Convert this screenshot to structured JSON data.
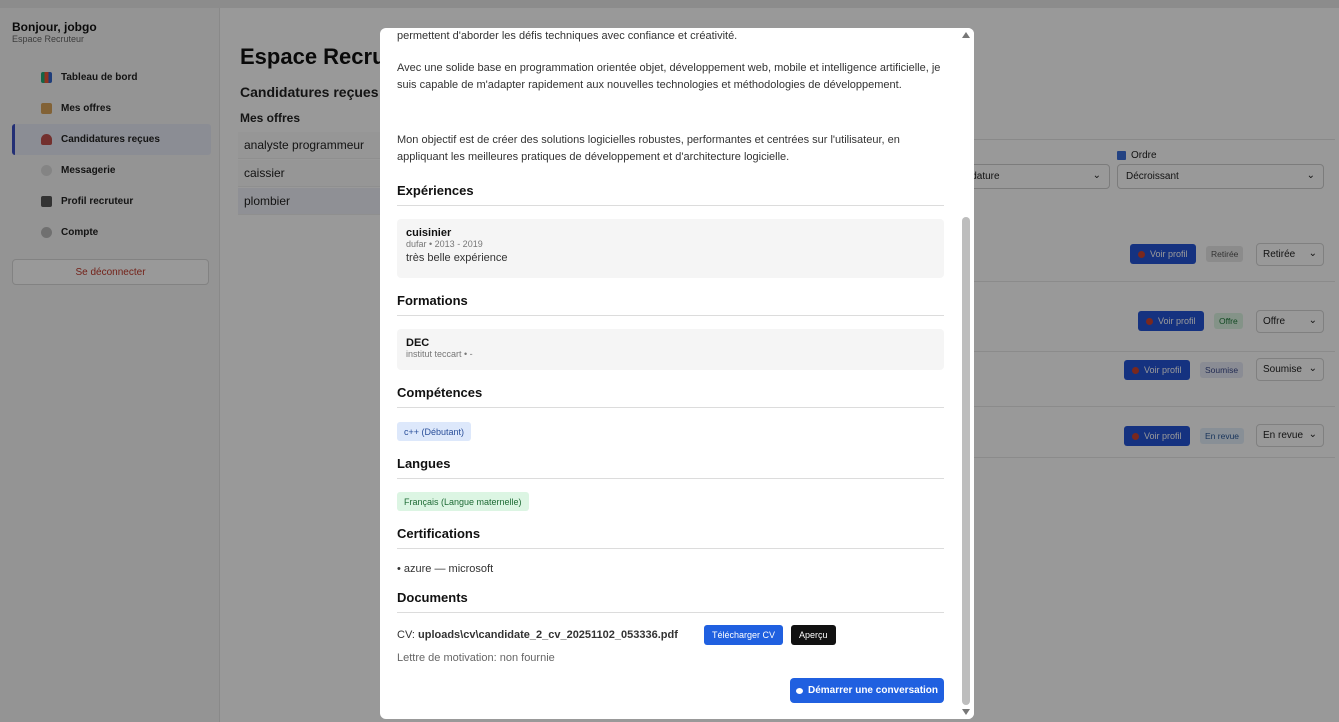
{
  "sidebar": {
    "greeting": "Bonjour, jobgo",
    "subtitle": "Espace Recruteur",
    "items": [
      {
        "label": "Tableau de bord",
        "icon": "chart-icon"
      },
      {
        "label": "Mes offres",
        "icon": "clipboard-icon"
      },
      {
        "label": "Candidatures reçues",
        "icon": "user-icon"
      },
      {
        "label": "Messagerie",
        "icon": "chat-icon"
      },
      {
        "label": "Profil recruteur",
        "icon": "building-icon"
      },
      {
        "label": "Compte",
        "icon": "gear-icon"
      }
    ],
    "logout_label": "Se déconnecter"
  },
  "main": {
    "title": "Espace Recru",
    "subtitle": "Candidatures reçues",
    "offers_label": "Mes offres",
    "offers": [
      "analyste programmeur",
      "caissier",
      "plombier"
    ],
    "order_label": "Ordre",
    "sort_value": "idature",
    "order_value": "Décroissant",
    "rows": [
      {
        "btn": "Voir profil",
        "badge": "Retirée",
        "status": "Retirée"
      },
      {
        "btn": "Voir profil",
        "badge": "Offre",
        "status": "Offre"
      },
      {
        "btn": "Voir profil",
        "badge": "Soumise",
        "status": "Soumise"
      },
      {
        "btn": "Voir profil",
        "badge": "En revue",
        "status": "En revue"
      }
    ]
  },
  "modal": {
    "intro_tail": "permettent d'aborder les défis techniques avec confiance et créativité.",
    "para2": "Avec une solide base en programmation orientée objet, développement web, mobile et intelligence artificielle, je suis capable de m'adapter rapidement aux nouvelles technologies et méthodologies de développement.",
    "para3": "Mon objectif est de créer des solutions logicielles robustes, performantes et centrées sur l'utilisateur, en appliquant les meilleures pratiques de développement et d'architecture logicielle.",
    "experiences_title": "Expériences",
    "experience": {
      "title": "cuisinier",
      "meta": "dufar • 2013 - 2019",
      "desc": "très belle expérience"
    },
    "formations_title": "Formations",
    "formation": {
      "title": "DEC",
      "meta": "institut teccart • -"
    },
    "competences_title": "Compétences",
    "competence_chip": "c++ (Débutant)",
    "langues_title": "Langues",
    "langue_chip": "Français (Langue maternelle)",
    "certifications_title": "Certifications",
    "certification": "• azure — microsoft",
    "documents_title": "Documents",
    "cv_prefix": "CV: ",
    "cv_file": "uploads\\cv\\candidate_2_cv_20251102_053336.pdf",
    "download_label": "Télécharger CV",
    "preview_label": "Aperçu",
    "motivation": "Lettre de motivation: non fournie",
    "start_conv_label": "Démarrer une conversation"
  },
  "colors": {
    "accent": "#2060e0",
    "success_bg": "#dcf5e3",
    "chip_bg": "#dde8fb"
  }
}
